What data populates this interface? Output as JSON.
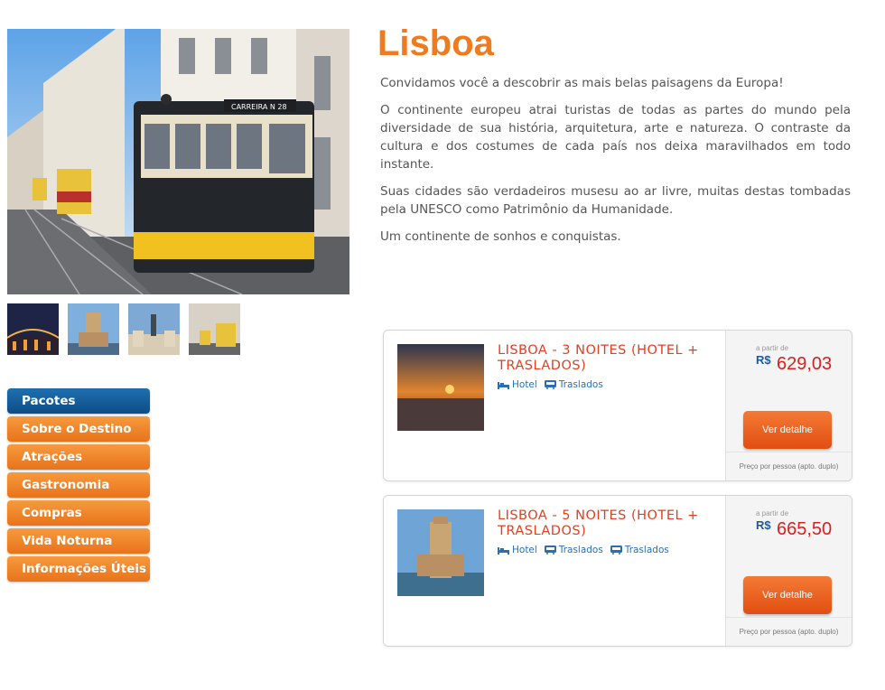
{
  "page": {
    "title": "Lisboa",
    "paragraphs": [
      "Convidamos você a descobrir as mais belas paisagens da Europa!",
      "O continente europeu atrai turistas de todas as partes do mundo pela diversidade de sua história, arquitetura, arte e natureza. O contraste da cultura e dos costumes de cada país nos deixa maravilhados em todo instante.",
      "Suas cidades são verdadeiros musesu ao ar livre, muitas destas tombadas pela UNESCO como Patrimônio da Humanidade.",
      "Um continente de sonhos e conquistas."
    ]
  },
  "gallery": {
    "main": "lisbon-tram-street-photo",
    "thumbs": [
      "bridge-at-night-thumb",
      "belem-tower-thumb",
      "praca-do-comercio-thumb",
      "tram-street-thumb"
    ]
  },
  "menu": {
    "items": [
      {
        "label": "Pacotes",
        "active": true
      },
      {
        "label": "Sobre o Destino",
        "active": false
      },
      {
        "label": "Atrações",
        "active": false
      },
      {
        "label": "Gastronomia",
        "active": false
      },
      {
        "label": "Compras",
        "active": false
      },
      {
        "label": "Vida Noturna",
        "active": false
      },
      {
        "label": "Informações Úteis",
        "active": false
      }
    ]
  },
  "packages": [
    {
      "title": "LISBOA - 3 NOITES (HOTEL + TRASLADOS)",
      "features": [
        {
          "label": "Hotel",
          "icon": "bed-icon"
        },
        {
          "label": "Traslados",
          "icon": "bus-icon"
        }
      ],
      "from_label": "a partir de",
      "currency": "R$",
      "price": "629,03",
      "button": "Ver detalhe",
      "note": "Preço por pessoa (apto. duplo)"
    },
    {
      "title": "LISBOA - 5 NOITES (HOTEL + TRASLADOS)",
      "features": [
        {
          "label": "Hotel",
          "icon": "bed-icon"
        },
        {
          "label": "Traslados",
          "icon": "bus-icon"
        },
        {
          "label": "Traslados",
          "icon": "bus-icon"
        }
      ],
      "from_label": "a partir de",
      "currency": "R$",
      "price": "665,50",
      "button": "Ver detalhe",
      "note": "Preço por pessoa (apto. duplo)"
    }
  ],
  "colors": {
    "accent_orange": "#f07a1e",
    "menu_active": "#0c4d86",
    "price_red": "#d8201f",
    "link_blue": "#2a6fb5"
  }
}
